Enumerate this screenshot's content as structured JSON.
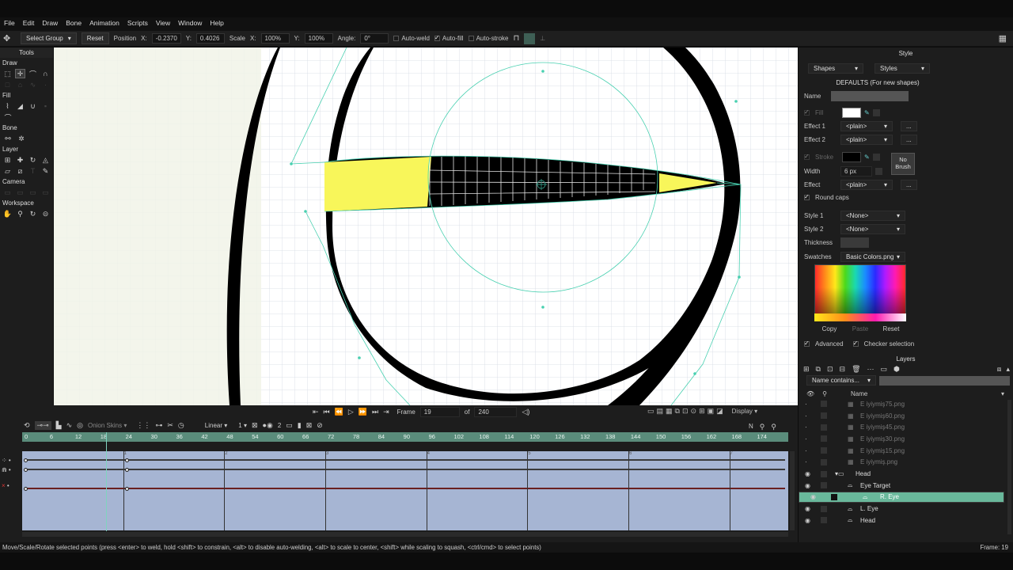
{
  "menu": [
    "File",
    "Edit",
    "Draw",
    "Bone",
    "Animation",
    "Scripts",
    "View",
    "Window",
    "Help"
  ],
  "toolbar": {
    "tool_select": "Select Group",
    "reset": "Reset",
    "position_label": "Position",
    "x_label": "X:",
    "x_value": "-0.2370",
    "y_label": "Y:",
    "y_value": "0.4026",
    "scale_label": "Scale",
    "sx_label": "X:",
    "sx_value": "100%",
    "sy_label": "Y:",
    "sy_value": "100%",
    "angle_label": "Angle:",
    "angle_value": "0°",
    "auto_weld": "Auto-weld",
    "auto_fill": "Auto-fill",
    "auto_stroke": "Auto-stroke"
  },
  "tools": {
    "title": "Tools",
    "sections": [
      "Draw",
      "Fill",
      "Bone",
      "Layer",
      "Camera",
      "Workspace"
    ]
  },
  "style": {
    "title": "Style",
    "shapes": "Shapes",
    "styles": "Styles",
    "defaults": "DEFAULTS (For new shapes)",
    "name_label": "Name",
    "fill_label": "Fill",
    "effect1_label": "Effect 1",
    "effect1_value": "<plain>",
    "effect2_label": "Effect 2",
    "effect2_value": "<plain>",
    "stroke_label": "Stroke",
    "no_brush": "No Brush",
    "width_label": "Width",
    "width_value": "6 px",
    "effect_label": "Effect",
    "effect_value": "<plain>",
    "round_caps": "Round caps",
    "style1_label": "Style 1",
    "style1_value": "<None>",
    "style2_label": "Style 2",
    "style2_value": "<None>",
    "thickness_label": "Thickness",
    "swatches_label": "Swatches",
    "swatches_value": "Basic Colors.png",
    "copy": "Copy",
    "paste": "Paste",
    "reset": "Reset",
    "advanced": "Advanced",
    "checker": "Checker selection",
    "fill_color": "#ffffff",
    "stroke_color": "#000000"
  },
  "layers": {
    "title": "Layers",
    "filter": "Name contains...",
    "name_header": "Name",
    "rows": [
      {
        "name": "E iyiymiş75.png",
        "dim": true,
        "indent": 1
      },
      {
        "name": "E iyiymiş60.png",
        "dim": true,
        "indent": 1
      },
      {
        "name": "E iyiymiş45.png",
        "dim": true,
        "indent": 1
      },
      {
        "name": "E iyiymiş30.png",
        "dim": true,
        "indent": 1
      },
      {
        "name": "E iyiymiş15.png",
        "dim": true,
        "indent": 1
      },
      {
        "name": "E iyiymiş.png",
        "dim": true,
        "indent": 1
      },
      {
        "name": "Head",
        "dim": false,
        "indent": 0
      },
      {
        "name": "Eye Target",
        "dim": false,
        "indent": 1
      },
      {
        "name": "R. Eye",
        "dim": false,
        "indent": 1,
        "selected": true
      },
      {
        "name": "L. Eye",
        "dim": false,
        "indent": 1
      },
      {
        "name": "Head",
        "dim": false,
        "indent": 1
      }
    ]
  },
  "playback": {
    "frame_label": "Frame",
    "frame_value": "19",
    "of_label": "of",
    "total": "240",
    "display": "Display"
  },
  "timeline": {
    "onion": "Onion Skins",
    "interp": "Linear",
    "step": "1",
    "keys": "2",
    "n_label": "N",
    "ruler": [
      "0",
      "6",
      "12",
      "18",
      "24",
      "30",
      "36",
      "42",
      "48",
      "54",
      "60",
      "66",
      "72",
      "78",
      "84",
      "90",
      "96",
      "102",
      "108",
      "114",
      "120",
      "126",
      "132",
      "138",
      "144",
      "150",
      "156",
      "162",
      "168",
      "174"
    ],
    "marks": [
      "1",
      "2",
      "3",
      "4",
      "5",
      "6",
      "7"
    ]
  },
  "status": {
    "text": "Move/Scale/Rotate selected points (press <enter> to weld, hold <shift> to constrain, <alt> to disable auto-welding, <alt> to scale to center, <shift> while scaling to squash, <ctrl/cmd> to select points)",
    "frame": "Frame: 19"
  },
  "colors": {
    "accent": "#69b89b",
    "timeline_bg": "#a6b5d3",
    "fill_yellow": "#f8f65a"
  }
}
